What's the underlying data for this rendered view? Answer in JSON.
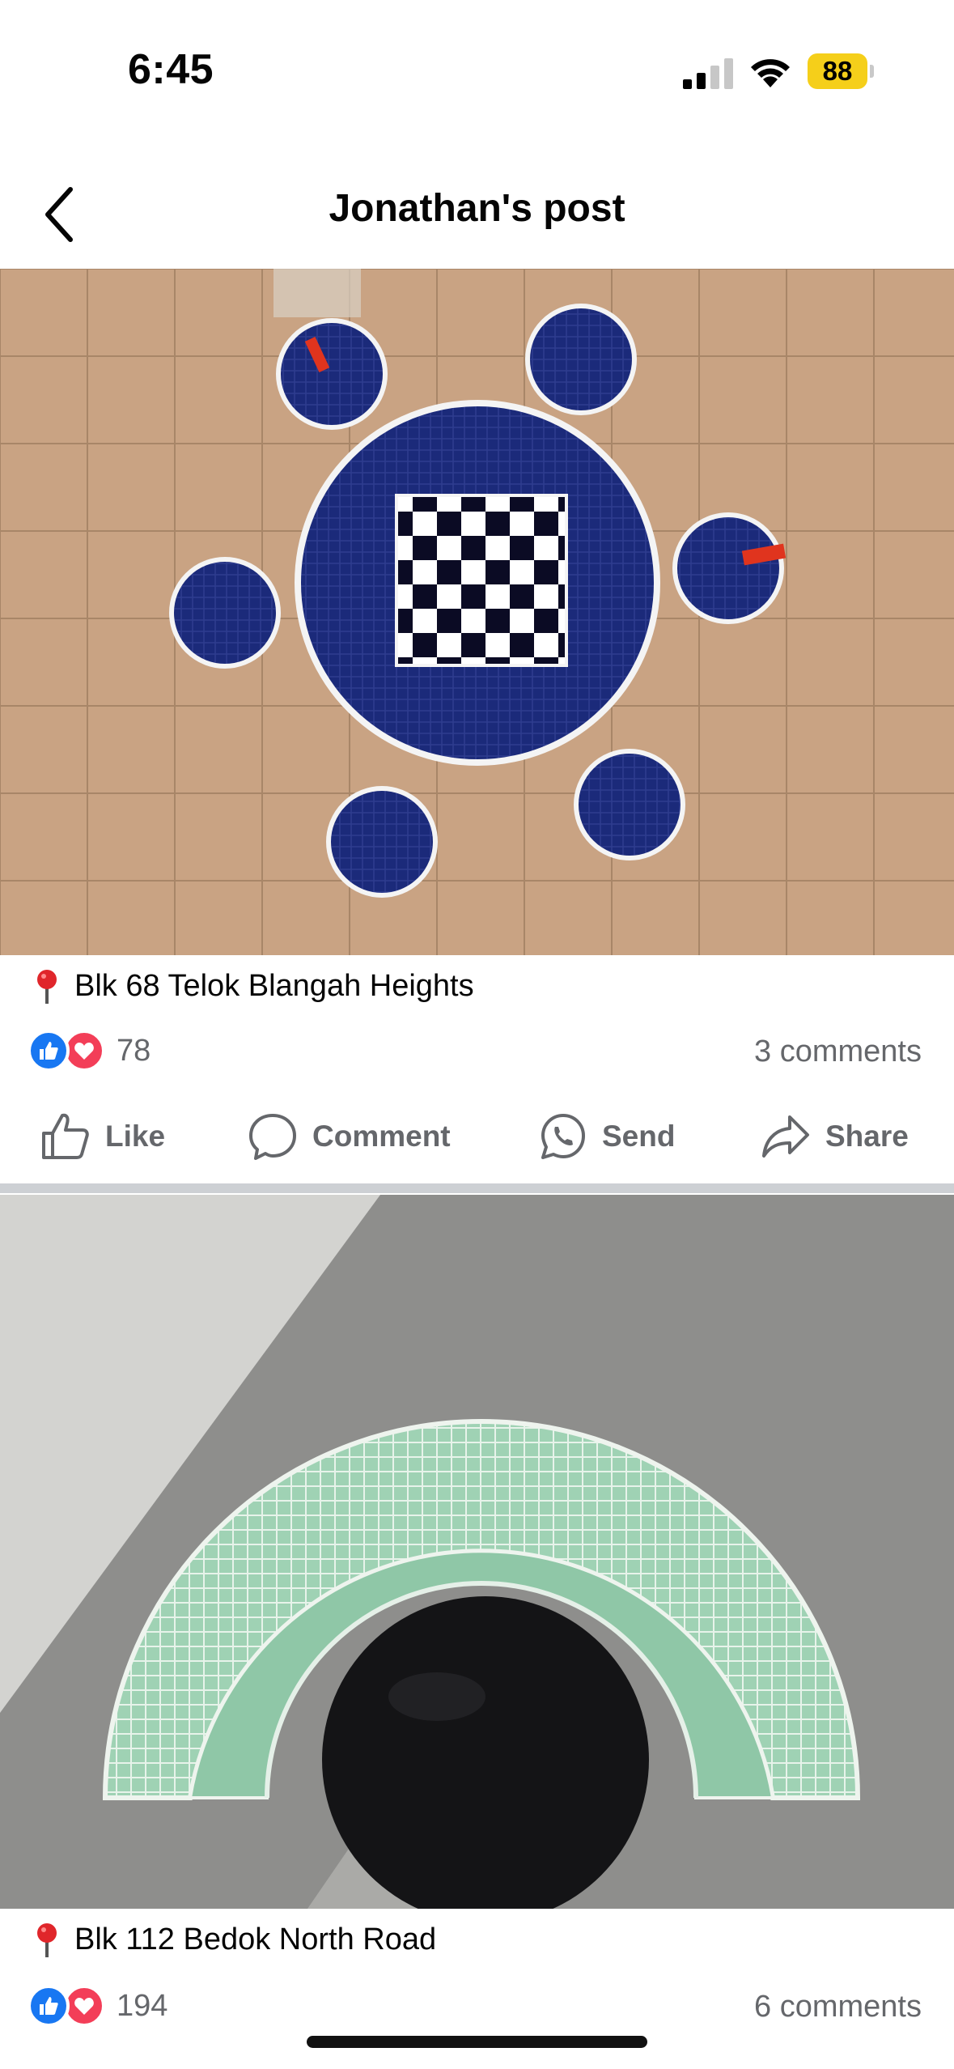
{
  "status_bar": {
    "time": "6:45",
    "battery": "88",
    "battery_color": "#f5cf1a"
  },
  "header": {
    "title": "Jonathan's post",
    "back_icon": "chevron-left-icon"
  },
  "posts": [
    {
      "location": "Blk 68 Telok Blangah Heights",
      "reaction_count": "78",
      "comments": "3 comments"
    },
    {
      "location": "Blk 112 Bedok North Road",
      "reaction_count": "194",
      "comments": "6 comments"
    }
  ],
  "actions": {
    "like": "Like",
    "comment": "Comment",
    "send": "Send",
    "share": "Share"
  },
  "colors": {
    "accent": "#1877f2",
    "love": "#f33e58",
    "muted_text": "#65676b"
  }
}
